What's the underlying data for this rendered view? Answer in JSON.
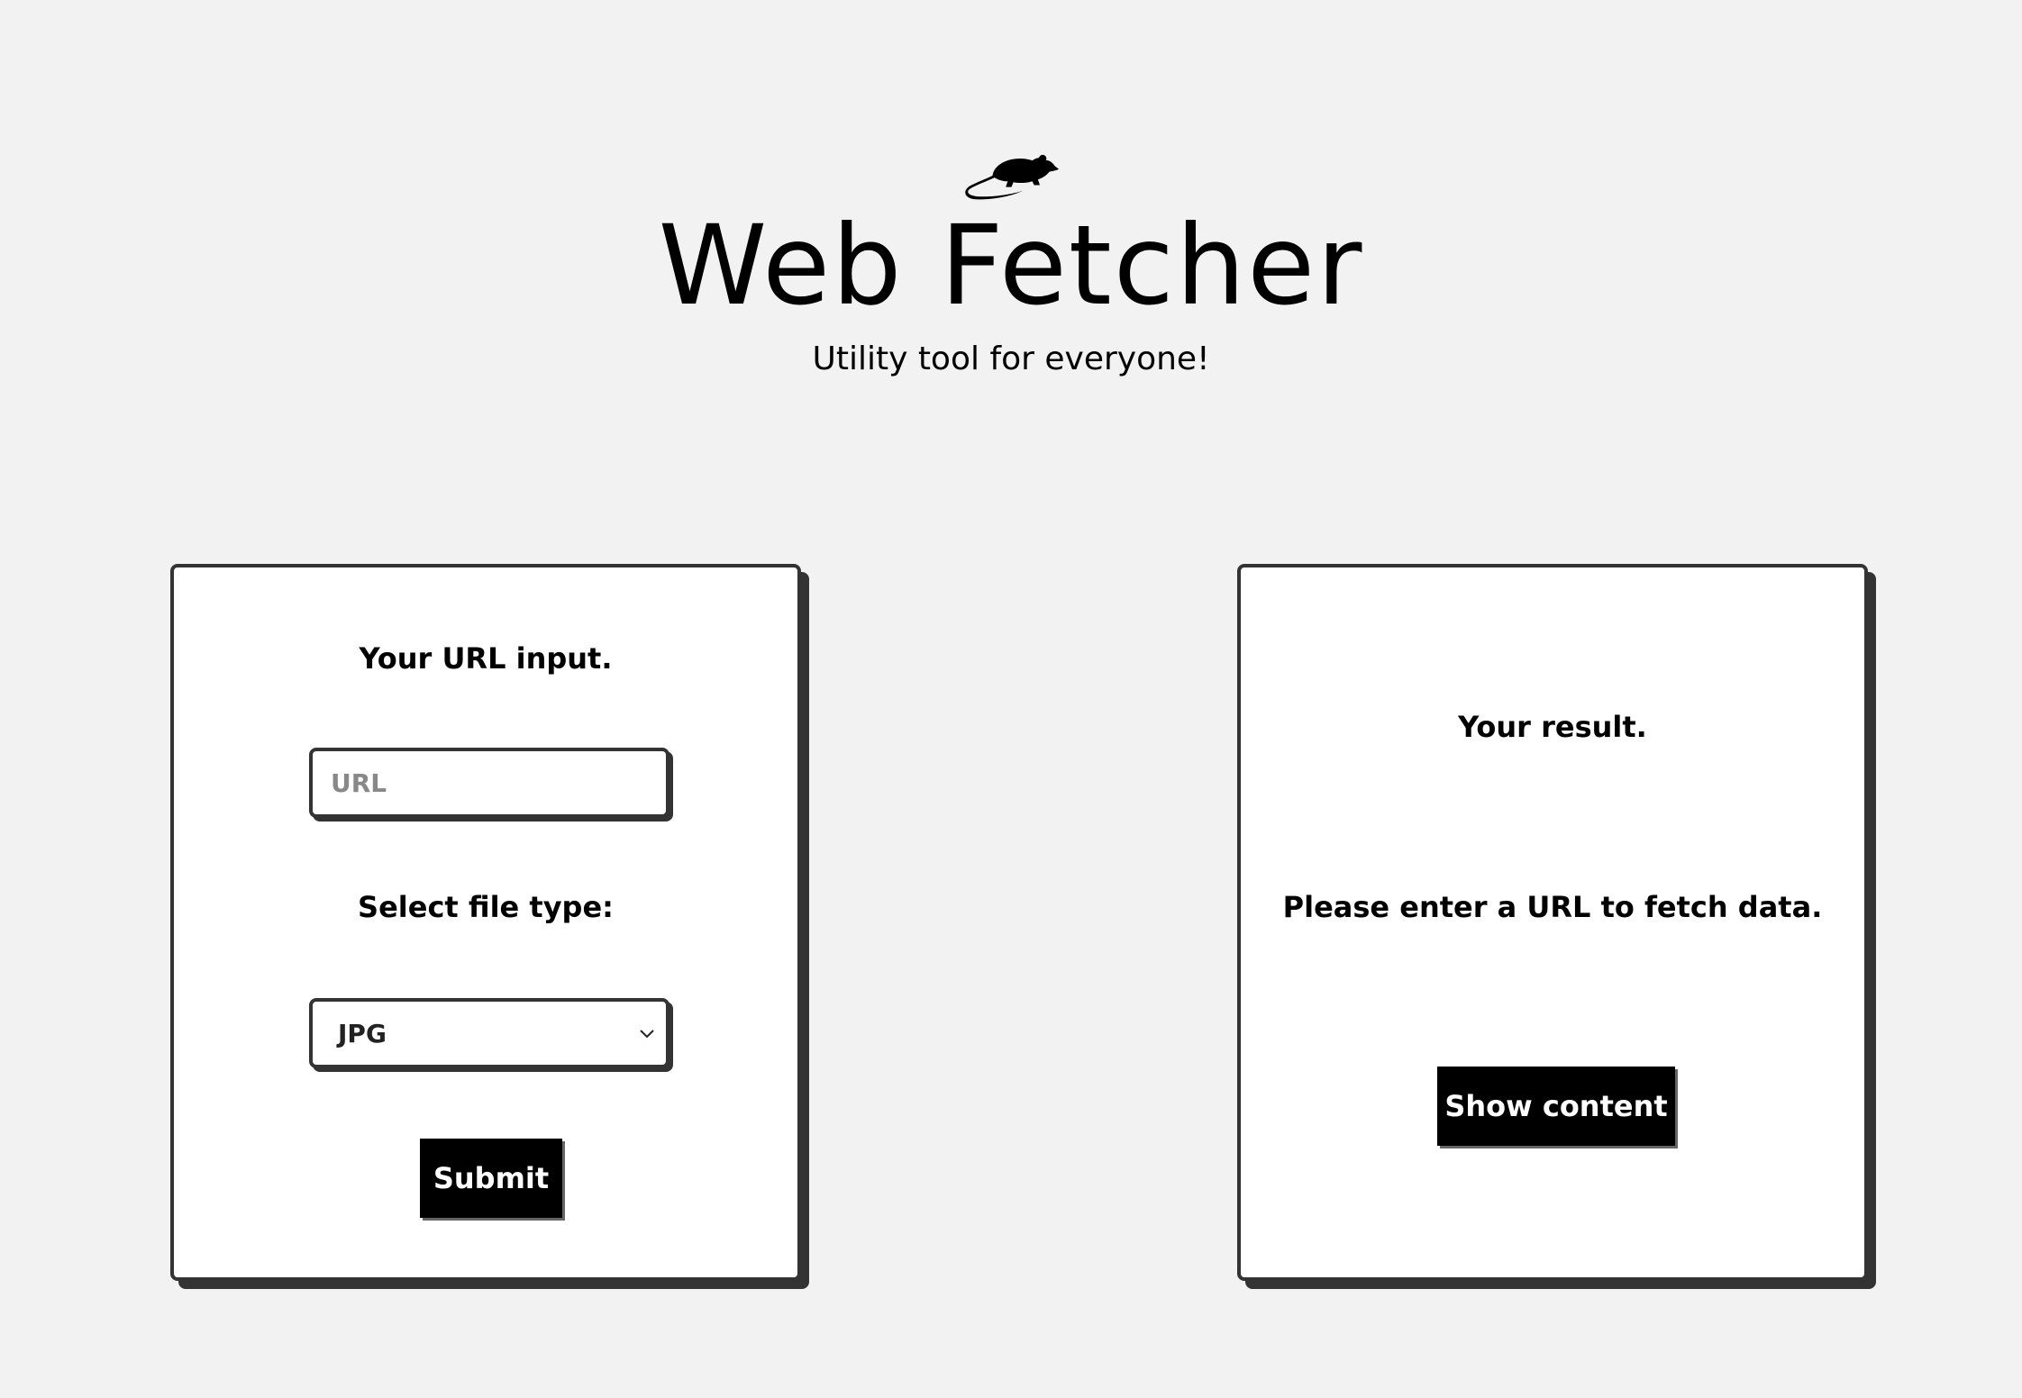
{
  "header": {
    "logo_icon": "rat-icon",
    "title": "Web Fetcher",
    "subtitle": "Utility tool for everyone!"
  },
  "input_card": {
    "heading": "Your URL input.",
    "url_placeholder": "URL",
    "url_value": "",
    "file_type_label": "Select file type:",
    "file_type_selected": "JPG",
    "submit_label": "Submit"
  },
  "result_card": {
    "heading": "Your result.",
    "message": "Please enter a URL to fetch data.",
    "show_button_label": "Show content"
  },
  "colors": {
    "background": "#f2f2f2",
    "card": "#ffffff",
    "border": "#333333",
    "button": "#000000",
    "button_text": "#ffffff"
  }
}
